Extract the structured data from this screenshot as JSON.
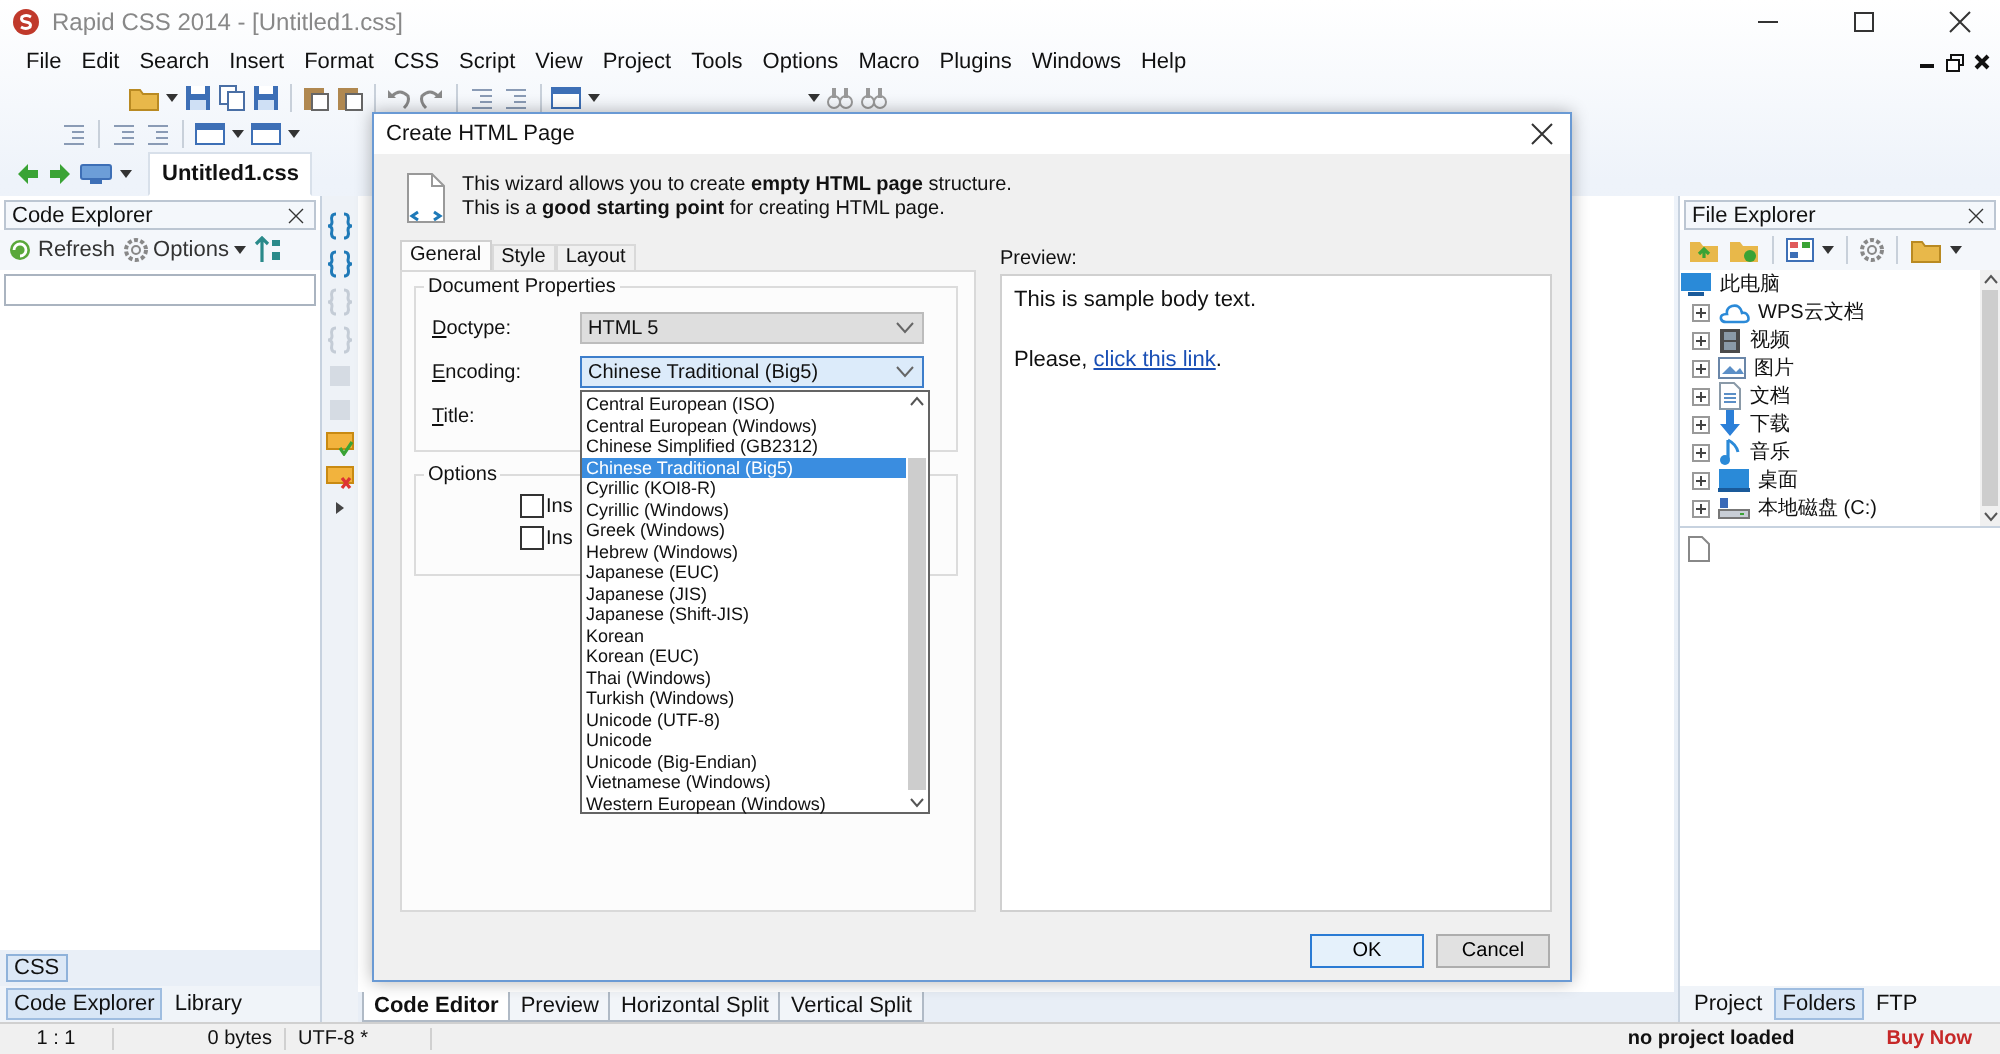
{
  "window": {
    "title": "Rapid CSS 2014 - [Untitled1.css]"
  },
  "menu": [
    "File",
    "Edit",
    "Search",
    "Insert",
    "Format",
    "CSS",
    "Script",
    "View",
    "Project",
    "Tools",
    "Options",
    "Macro",
    "Plugins",
    "Windows",
    "Help"
  ],
  "document_tabs": [
    {
      "label": "Untitled1.css",
      "selected": true
    }
  ],
  "code_explorer": {
    "title": "Code Explorer",
    "refresh": "Refresh",
    "options": "Options",
    "css_tab": "CSS",
    "tabs": [
      {
        "label": "Code Explorer",
        "selected": true
      },
      {
        "label": "Library",
        "selected": false
      }
    ]
  },
  "editor_tabs": [
    {
      "label": "Code Editor",
      "selected": true
    },
    {
      "label": "Preview",
      "selected": false
    },
    {
      "label": "Horizontal Split",
      "selected": false
    },
    {
      "label": "Vertical Split",
      "selected": false
    }
  ],
  "file_explorer": {
    "title": "File Explorer",
    "tree": [
      {
        "label": "此电脑",
        "kind": "computer",
        "children": [
          {
            "label": "WPS云文档",
            "kind": "cloud",
            "expanded": false
          },
          {
            "label": "视频",
            "kind": "video",
            "expanded": false
          },
          {
            "label": "图片",
            "kind": "pictures",
            "expanded": false
          },
          {
            "label": "文档",
            "kind": "documents",
            "expanded": false
          },
          {
            "label": "下载",
            "kind": "downloads",
            "expanded": false
          },
          {
            "label": "音乐",
            "kind": "music",
            "expanded": false
          },
          {
            "label": "桌面",
            "kind": "desktop",
            "expanded": false
          },
          {
            "label": "本地磁盘 (C:)",
            "kind": "drive",
            "expanded": false
          }
        ]
      }
    ],
    "tabs": [
      {
        "label": "Project",
        "selected": false
      },
      {
        "label": "Folders",
        "selected": true
      },
      {
        "label": "FTP",
        "selected": false
      }
    ]
  },
  "status_bar": {
    "position": "1 : 1",
    "size": "0 bytes",
    "encoding": "UTF-8 *",
    "project": "no project loaded",
    "buy": "Buy Now"
  },
  "dialog": {
    "title": "Create HTML Page",
    "intro": [
      "This wizard allows you to create **empty HTML page** structure.",
      "This is a **good starting point** for creating HTML page."
    ],
    "tabs": [
      {
        "label": "General",
        "selected": true
      },
      {
        "label": "Style",
        "selected": false
      },
      {
        "label": "Layout",
        "selected": false
      }
    ],
    "properties_group": "Document Properties",
    "doctype": {
      "label": "Doctype:",
      "value": "HTML 5"
    },
    "encoding": {
      "label": "Encoding:",
      "value": "Chinese Traditional (Big5)",
      "expanded": true,
      "options": [
        {
          "label": "Central European (ISO)",
          "selected": false
        },
        {
          "label": "Central European (Windows)",
          "selected": false
        },
        {
          "label": "Chinese Simplified (GB2312)",
          "selected": false
        },
        {
          "label": "Chinese Traditional (Big5)",
          "selected": true
        },
        {
          "label": "Cyrillic (KOI8-R)",
          "selected": false
        },
        {
          "label": "Cyrillic (Windows)",
          "selected": false
        },
        {
          "label": "Greek (Windows)",
          "selected": false
        },
        {
          "label": "Hebrew (Windows)",
          "selected": false
        },
        {
          "label": "Japanese (EUC)",
          "selected": false
        },
        {
          "label": "Japanese (JIS)",
          "selected": false
        },
        {
          "label": "Japanese (Shift-JIS)",
          "selected": false
        },
        {
          "label": "Korean",
          "selected": false
        },
        {
          "label": "Korean (EUC)",
          "selected": false
        },
        {
          "label": "Thai (Windows)",
          "selected": false
        },
        {
          "label": "Turkish (Windows)",
          "selected": false
        },
        {
          "label": "Unicode (UTF-8)",
          "selected": false
        },
        {
          "label": "Unicode",
          "selected": false
        },
        {
          "label": "Unicode (Big-Endian)",
          "selected": false
        },
        {
          "label": "Vietnamese (Windows)",
          "selected": false
        },
        {
          "label": "Western European (Windows)",
          "selected": false
        }
      ]
    },
    "title_label": "Title:",
    "options_group": "Options",
    "options": [
      {
        "label": "Ins",
        "checked": false
      },
      {
        "label": "Ins",
        "checked": false
      }
    ],
    "preview_label": "Preview:",
    "preview": {
      "body": "This is sample body text.",
      "before_link": "Please, ",
      "link": "click this link",
      "after_link": "."
    },
    "buttons": [
      {
        "label": "OK",
        "default": true
      },
      {
        "label": "Cancel",
        "default": false
      }
    ]
  }
}
